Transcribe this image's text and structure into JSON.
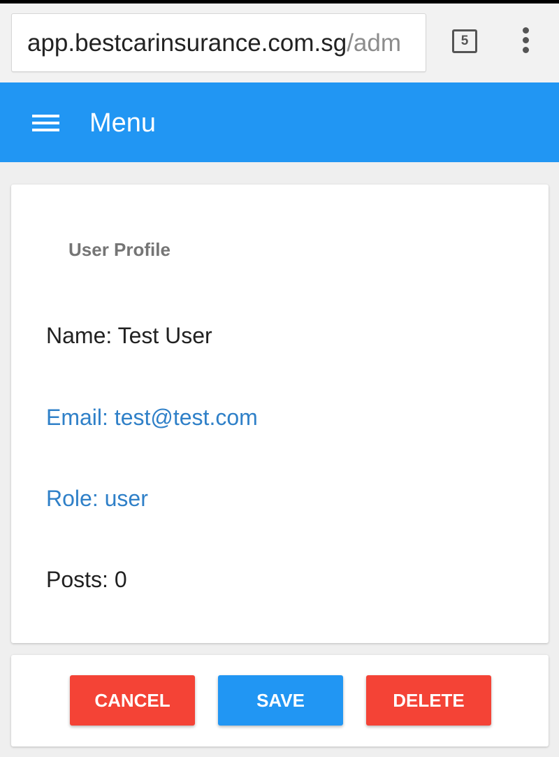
{
  "browser": {
    "url_host": "app.bestcarinsurance.com.sg",
    "url_path": "/adm",
    "tab_count": "5"
  },
  "header": {
    "title": "Menu",
    "background_color": "#2196f3"
  },
  "profile": {
    "title": "User Profile",
    "name": "Name: Test User",
    "email": "Email: test@test.com",
    "role": "Role: user",
    "posts": "Posts: 0",
    "link_color": "#2f80c8"
  },
  "actions": {
    "cancel_label": "CANCEL",
    "save_label": "SAVE",
    "delete_label": "DELETE",
    "danger_color": "#f44336",
    "primary_color": "#2196f3"
  }
}
